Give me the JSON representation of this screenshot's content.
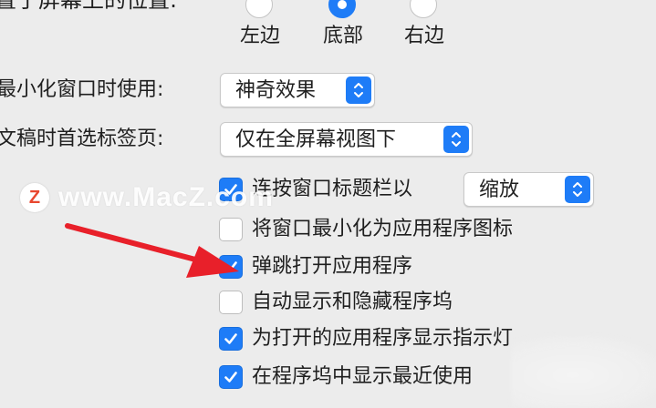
{
  "top_label": "置于屏幕上的位置:",
  "position_radios": [
    {
      "label": "左边",
      "selected": false
    },
    {
      "label": "底部",
      "selected": true
    },
    {
      "label": "右边",
      "selected": false
    }
  ],
  "minimize_row": {
    "label": "最小化窗口时使用:",
    "value": "神奇效果"
  },
  "tabs_row": {
    "label": "文稿时首选标签页:",
    "value": "仅在全屏幕视图下"
  },
  "double_click_row": {
    "label": "连按窗口标题栏以",
    "checked": true,
    "popup_value": "缩放"
  },
  "checkboxes": [
    {
      "label": "将窗口最小化为应用程序图标",
      "checked": false
    },
    {
      "label": "弹跳打开应用程序",
      "checked": true
    },
    {
      "label": "自动显示和隐藏程序坞",
      "checked": false
    },
    {
      "label": "为打开的应用程序显示指示灯",
      "checked": true
    },
    {
      "label": "在程序坞中显示最近使用",
      "checked": true
    }
  ],
  "watermark": {
    "logo": "Z",
    "text": "www.MacZ.com"
  },
  "colors": {
    "accent": "#1e7cf7",
    "background": "#ececec",
    "arrow": "#e8202a"
  },
  "icons": {
    "stepper": "up-down-chevron-icon",
    "checkmark": "checkmark-icon"
  }
}
